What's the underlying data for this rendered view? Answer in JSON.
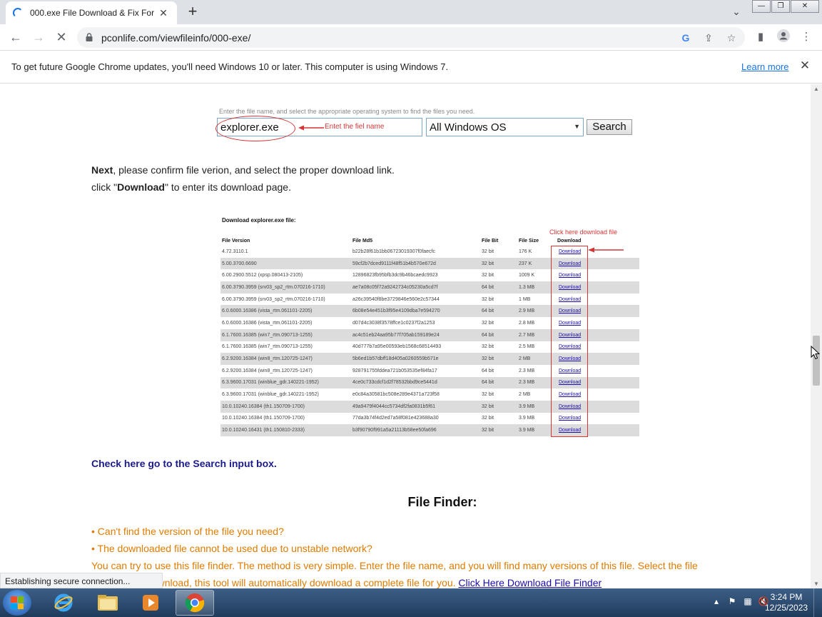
{
  "browser": {
    "tab_title": "000.exe File Download & Fix For",
    "url": "pconlife.com/viewfileinfo/000-exe/",
    "window_buttons": [
      "—",
      "❐",
      "✕"
    ]
  },
  "infobar": {
    "message": "To get future Google Chrome updates, you'll need Windows 10 or later. This computer is using Windows 7.",
    "learn_more": "Learn more"
  },
  "search_demo": {
    "hint": "Enter the file name, and select the appropriate operating system to find the files you need.",
    "filename_value": "explorer.exe",
    "annotation": "Entet the fiel name",
    "os_value": "All Windows OS",
    "search_button": "Search"
  },
  "instructions": {
    "line1_bold": "Next",
    "line1_rest": ", please confirm file verion, and select the proper download link.",
    "line2_pre": "click \"",
    "line2_bold": "Download",
    "line2_post": "\" to enter its download page."
  },
  "download_table": {
    "title": "Download explorer.exe file:",
    "annotation": "Click here download file",
    "headers": [
      "File Version",
      "File Md5",
      "File Bit",
      "File Size",
      "Download"
    ],
    "rows": [
      [
        "4.72.3110.1",
        "b22b28f61b1bb06723019307f0faecfc",
        "32 bit",
        "176 K",
        "Download"
      ],
      [
        "5.00.3700.6690",
        "59cf2b7dced9111f48f51b4b570e672d",
        "32 bit",
        "237 K",
        "Download"
      ],
      [
        "6.00.2900.5512 (xpsp.080413-2105)",
        "12896823fb95bfb3dc9b46bcaedc9923",
        "32 bit",
        "1009 K",
        "Download"
      ],
      [
        "6.00.3790.3959 (srv03_sp2_rtm.070216-1710)",
        "ae7a08c05f72a9242734c05230a5cd7f",
        "64 bit",
        "1.3 MB",
        "Download"
      ],
      [
        "6.00.3790.3959 (srv03_sp2_rtm.070216-1710)",
        "a26c39540f8be3729846e560e2c57344",
        "32 bit",
        "1 MB",
        "Download"
      ],
      [
        "6.0.6000.16386 (vista_rtm.061101-2205)",
        "6b08e54e451b3f95e4109dba7e594270",
        "64 bit",
        "2.9 MB",
        "Download"
      ],
      [
        "6.0.6000.16386 (vista_rtm.061101-2205)",
        "d07d4c3038f3578ffce1c0237f2a1253",
        "32 bit",
        "2.8 MB",
        "Download"
      ],
      [
        "6.1.7600.16385 (win7_rtm.090713-1255)",
        "ac4c51eb24aa95b77f705ab159189e24",
        "64 bit",
        "2.7 MB",
        "Download"
      ],
      [
        "6.1.7600.16385 (win7_rtm.090713-1255)",
        "40d777b7a95e00593eb1568c68514493",
        "32 bit",
        "2.5 MB",
        "Download"
      ],
      [
        "6.2.9200.16384 (win8_rtm.120725-1247)",
        "5b6ed1b57dbff18d405a0260559b571e",
        "32 bit",
        "2 MB",
        "Download"
      ],
      [
        "6.2.9200.16384 (win8_rtm.120725-1247)",
        "928791755fddea721b053535ef84fa17",
        "64 bit",
        "2.3 MB",
        "Download"
      ],
      [
        "6.3.9600.17031 (winblue_gdr.140221-1952)",
        "4ce0c733cdcf1d2f78532bbd9ce5441d",
        "64 bit",
        "2.3 MB",
        "Download"
      ],
      [
        "6.3.9600.17031 (winblue_gdr.140221-1952)",
        "e0c84a30581bc508e289e4371a723f58",
        "32 bit",
        "2 MB",
        "Download"
      ],
      [
        "10.0.10240.16384 (th1.150709-1700)",
        "49a9479f4044cc5734df2fa0831b5f61",
        "32 bit",
        "3.9 MB",
        "Download"
      ],
      [
        "10.0.10240.16384 (th1.150709-1700)",
        "77da3b74f4d2ed7a58f081e423688a30",
        "32 bit",
        "3.9 MB",
        "Download"
      ],
      [
        "10.0.10240.16431 (th1.150810-2333)",
        "b3f90790f991a5a21113b58ee50fa696",
        "32 bit",
        "3.9 MB",
        "Download"
      ]
    ]
  },
  "goto_search": "Check here go to the Search input box.",
  "finder": {
    "title": "File Finder:",
    "bullet1": "• Can't find the version of the file you need?",
    "bullet2": "• The downloaded file cannot be used due to unstable network?",
    "para1": "You can try to use this file finder. The method is very simple. Enter the file name, and you will find many versions of this file. Select the file",
    "para2_text": "you need to download, this tool will automatically download a complete file for you. ",
    "para2_link": "Click Here Download File Finder"
  },
  "status": "Establishing secure connection...",
  "taskbar": {
    "time": "3:24 PM",
    "date": "12/25/2023"
  },
  "colors": {
    "annotation_red": "#d43636",
    "finder_orange": "#e07b00",
    "link_navy": "#1a1a8c"
  }
}
